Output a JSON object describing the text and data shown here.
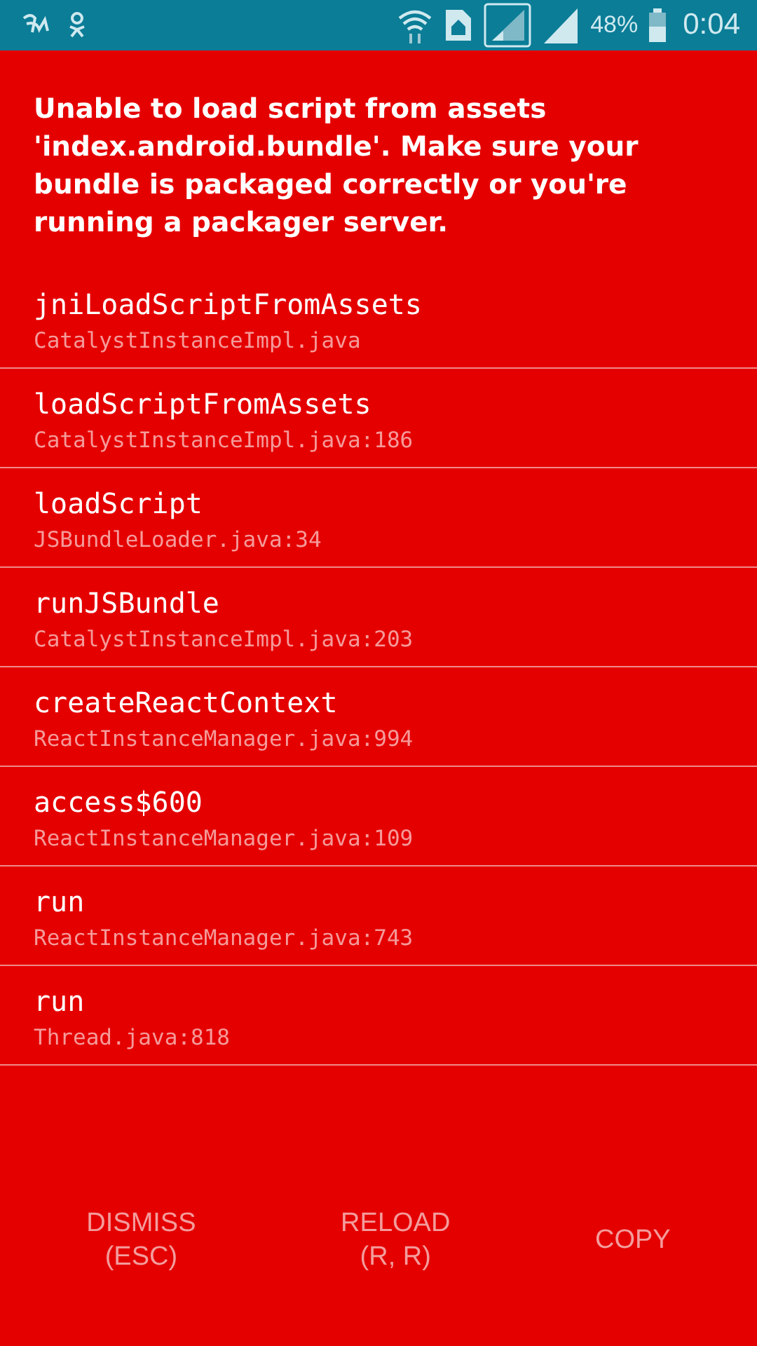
{
  "status_bar": {
    "battery": "48%",
    "time": "0:04"
  },
  "message": "Unable to load script from assets 'index.android.bundle'. Make sure your bundle is packaged correctly or you're running a packager server.",
  "stack": [
    {
      "method": "jniLoadScriptFromAssets",
      "location": "CatalystInstanceImpl.java"
    },
    {
      "method": "loadScriptFromAssets",
      "location": "CatalystInstanceImpl.java:186"
    },
    {
      "method": "loadScript",
      "location": "JSBundleLoader.java:34"
    },
    {
      "method": "runJSBundle",
      "location": "CatalystInstanceImpl.java:203"
    },
    {
      "method": "createReactContext",
      "location": "ReactInstanceManager.java:994"
    },
    {
      "method": "access$600",
      "location": "ReactInstanceManager.java:109"
    },
    {
      "method": "run",
      "location": "ReactInstanceManager.java:743"
    },
    {
      "method": "run",
      "location": "Thread.java:818"
    }
  ],
  "buttons": [
    {
      "label": "DISMISS",
      "shortcut": "(ESC)"
    },
    {
      "label": "RELOAD",
      "shortcut": "(R, R)"
    },
    {
      "label": "COPY"
    }
  ]
}
